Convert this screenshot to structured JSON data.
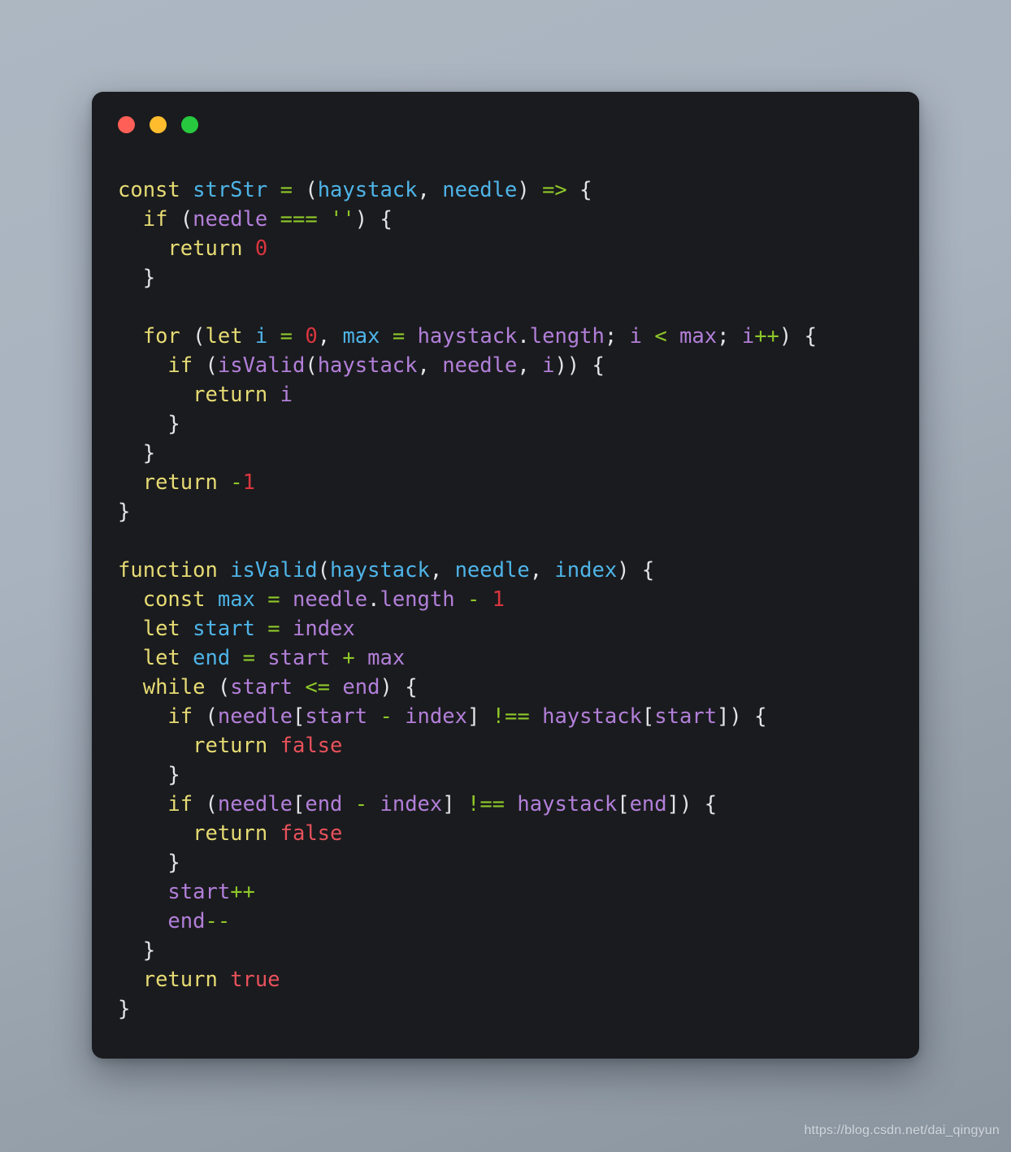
{
  "window": {
    "controls": [
      {
        "name": "close-button",
        "color": "#ff5f56"
      },
      {
        "name": "minimize-button",
        "color": "#ffbd2e"
      },
      {
        "name": "maximize-button",
        "color": "#27c93f"
      }
    ]
  },
  "theme": {
    "background": "#1a1b1e",
    "page_background_top": "#adb7c2",
    "page_background_bottom": "#8b959f",
    "keyword": "#e6db74",
    "declaration": "#4eb4e8",
    "reference": "#b27fd9",
    "operator": "#8fc829",
    "number": "#d9353f",
    "string": "#8fc829",
    "boolean": "#e8515b",
    "punctuation": "#e3e4e6"
  },
  "code": {
    "language": "javascript",
    "lines": [
      "const strStr = (haystack, needle) => {",
      "  if (needle === '') {",
      "    return 0",
      "  }",
      "",
      "  for (let i = 0, max = haystack.length; i < max; i++) {",
      "    if (isValid(haystack, needle, i)) {",
      "      return i",
      "    }",
      "  }",
      "  return -1",
      "}",
      "",
      "function isValid(haystack, needle, index) {",
      "  const max = needle.length - 1",
      "  let start = index",
      "  let end = start + max",
      "  while (start <= end) {",
      "    if (needle[start - index] !== haystack[start]) {",
      "      return false",
      "    }",
      "    if (needle[end - index] !== haystack[end]) {",
      "      return false",
      "    }",
      "    start++",
      "    end--",
      "  }",
      "  return true",
      "}"
    ]
  },
  "watermark": {
    "text": "https://blog.csdn.net/dai_qingyun"
  }
}
